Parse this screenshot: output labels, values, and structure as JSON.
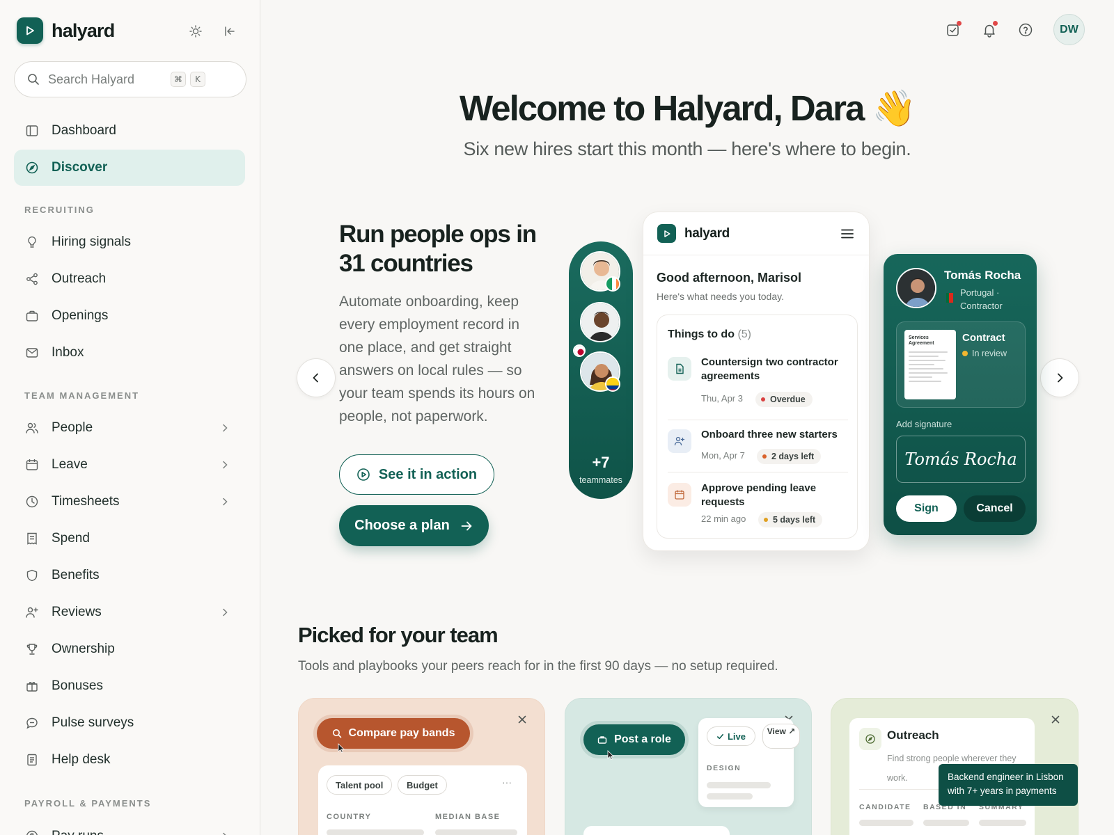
{
  "brand": {
    "name": "halyard",
    "accent": "#126155"
  },
  "search": {
    "placeholder": "Search Halyard",
    "kbd1": "⌘",
    "kbd2": "K"
  },
  "nav": {
    "primary": [
      {
        "label": "Dashboard",
        "icon": "sidebar-panel-icon"
      },
      {
        "label": "Discover",
        "icon": "compass-icon",
        "active": true
      }
    ],
    "sections": [
      {
        "title": "RECRUITING",
        "items": [
          {
            "label": "Hiring signals",
            "icon": "lightbulb-icon"
          },
          {
            "label": "Outreach",
            "icon": "share-icon"
          },
          {
            "label": "Openings",
            "icon": "briefcase-icon"
          },
          {
            "label": "Inbox",
            "icon": "mail-icon"
          }
        ]
      },
      {
        "title": "TEAM MANAGEMENT",
        "items": [
          {
            "label": "People",
            "icon": "users-icon"
          },
          {
            "label": "Leave",
            "icon": "calendar-icon"
          },
          {
            "label": "Timesheets",
            "icon": "clock-icon"
          },
          {
            "label": "Spend",
            "icon": "receipt-icon"
          },
          {
            "label": "Benefits",
            "icon": "shield-icon"
          },
          {
            "label": "Reviews",
            "icon": "user-plus-icon"
          },
          {
            "label": "Ownership",
            "icon": "trophy-icon"
          },
          {
            "label": "Bonuses",
            "icon": "gift-icon"
          },
          {
            "label": "Pulse surveys",
            "icon": "chat-icon"
          },
          {
            "label": "Help desk",
            "icon": "document-icon"
          }
        ]
      },
      {
        "title": "PAYROLL & PAYMENTS",
        "items": [
          {
            "label": "Pay runs",
            "icon": "money-icon"
          }
        ]
      }
    ]
  },
  "topbar": {
    "avatar_initials": "DW"
  },
  "hero": {
    "title": "Welcome to Halyard, Dara 👋",
    "subtitle": "Six new hires start this month — here's where to begin."
  },
  "promo": {
    "title": "Run people ops in 31 countries",
    "body": "Automate onboarding, keep every employment record in one place, and get straight answers on local rules — so your team spends its hours on people, not paperwork.",
    "secondary_cta": "See it in action",
    "primary_cta": "Choose a plan"
  },
  "team_strip": {
    "count": "+7",
    "label": "teammates"
  },
  "app_card": {
    "name": "halyard",
    "greeting": "Good afternoon, Marisol",
    "greeting_sub": "Here's what needs you today.",
    "todo_title": "Things to do",
    "todo_count": "(5)",
    "todos": [
      {
        "title": "Countersign two contractor agreements",
        "date": "Thu, Apr 3",
        "status": "Overdue",
        "status_color": "#d94040"
      },
      {
        "title": "Onboard three new starters",
        "date": "Mon, Apr 7",
        "status": "2 days left",
        "status_color": "#d9622b"
      },
      {
        "title": "Approve pending leave requests",
        "date": "22 min ago",
        "status": "5 days left",
        "status_color": "#e0a020"
      }
    ]
  },
  "contract_card": {
    "name": "Tomás Rocha",
    "meta": "Portugal · Contractor",
    "doc_title": "Services Agreement",
    "label": "Contract",
    "status": "In review",
    "add_signature": "Add signature",
    "signature": "Tomás Rocha",
    "sign": "Sign",
    "cancel": "Cancel"
  },
  "picked": {
    "title": "Picked for your team",
    "subtitle": "Tools and playbooks your peers reach for in the first 90 days — no setup required."
  },
  "tiles": {
    "pay": {
      "button": "Compare pay bands",
      "chip1": "Talent pool",
      "chip2": "Budget",
      "more": "···",
      "col1": "COUNTRY",
      "col2": "MEDIAN BASE"
    },
    "post": {
      "button": "Post a role",
      "live": "Live",
      "view": "View ↗",
      "design": "DESIGN"
    },
    "outreach": {
      "name": "Outreach",
      "desc": "Find strong people wherever they work.",
      "col1": "CANDIDATE",
      "col2": "BASED IN",
      "col3": "SUMMARY",
      "tooltip": "Backend engineer in Lisbon with 7+ years in payments"
    }
  }
}
